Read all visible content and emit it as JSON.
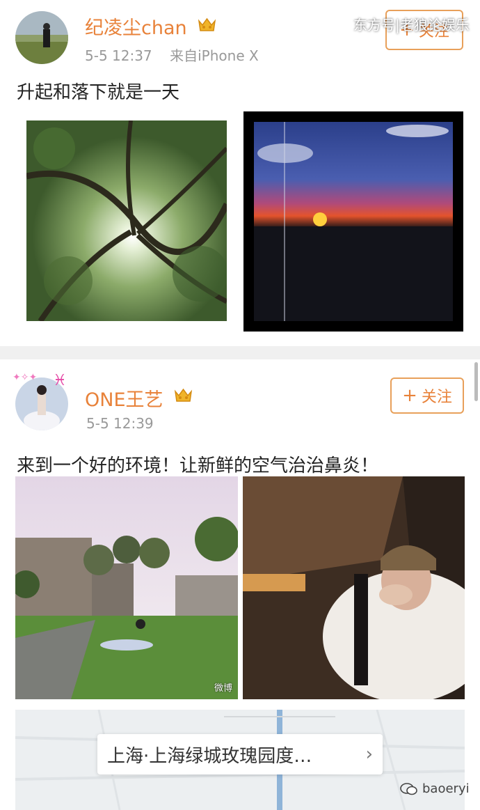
{
  "watermark": {
    "text": "东方号|老狼论娱乐"
  },
  "posts": [
    {
      "username": "纪凌尘chan",
      "time": "5-5 12:37",
      "source": "来自iPhone X",
      "follow_label": "关注",
      "text": "升起和落下就是一天"
    },
    {
      "username": "ONE王艺",
      "time": "5-5 12:39",
      "follow_label": "关注",
      "text": "来到一个好的环境！让新鲜的空气治治鼻炎！",
      "photo_watermark": "微博",
      "location": "上海·上海绿城玫瑰园度…"
    }
  ],
  "bottom_watermark": {
    "text": "baoeryi"
  },
  "colors": {
    "accent": "#e8823a",
    "follow_border": "#e8a05a",
    "meta": "#999999"
  },
  "icons": {
    "vip": "crown-badge-icon",
    "follow": "plus-icon",
    "location_arrow": "chevron-right-icon",
    "wechat": "wechat-icon"
  }
}
